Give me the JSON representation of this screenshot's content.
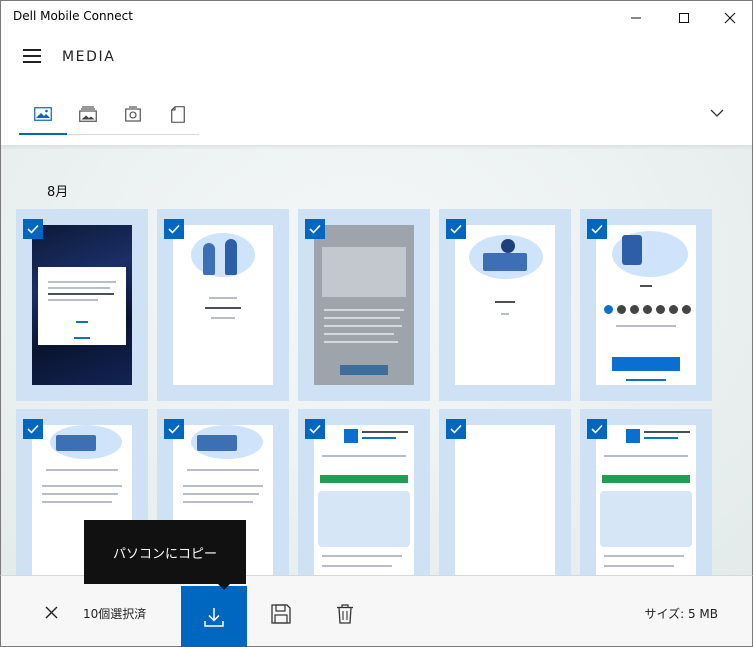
{
  "window": {
    "title": "Dell Mobile Connect",
    "minimize_icon": "minimize-icon",
    "maximize_icon": "maximize-icon",
    "close_icon": "close-icon"
  },
  "header": {
    "menu_icon": "hamburger-menu-icon",
    "title": "MEDIA",
    "tabs": [
      {
        "icon": "photos-icon",
        "selected": true
      },
      {
        "icon": "albums-icon",
        "selected": false
      },
      {
        "icon": "camera-roll-icon",
        "selected": false
      },
      {
        "icon": "documents-icon",
        "selected": false
      }
    ],
    "expand_icon": "chevron-down-icon"
  },
  "gallery": {
    "section_label": "8月",
    "items": [
      {
        "checked": true,
        "kind": "dark-popup"
      },
      {
        "checked": true,
        "kind": "illustration-people"
      },
      {
        "checked": true,
        "kind": "grey-screenshot"
      },
      {
        "checked": true,
        "kind": "illustration-laptop"
      },
      {
        "checked": true,
        "kind": "illustration-icons"
      },
      {
        "checked": true,
        "kind": "illustration-devices"
      },
      {
        "checked": true,
        "kind": "illustration-devices"
      },
      {
        "checked": true,
        "kind": "app-store-listing"
      },
      {
        "checked": true,
        "kind": "blank"
      },
      {
        "checked": true,
        "kind": "app-store-listing"
      }
    ]
  },
  "tooltip": {
    "text": "パソコンにコピー"
  },
  "bottom_bar": {
    "close_icon": "close-icon",
    "selected_count": "10個選択済",
    "download_icon": "download-icon",
    "save_icon": "save-icon",
    "delete_icon": "delete-icon",
    "size_info": "サイズ: 5 MB"
  },
  "colors": {
    "accent": "#0067c0",
    "tile_background": "#cfe2f5",
    "tooltip_background": "#111111"
  }
}
